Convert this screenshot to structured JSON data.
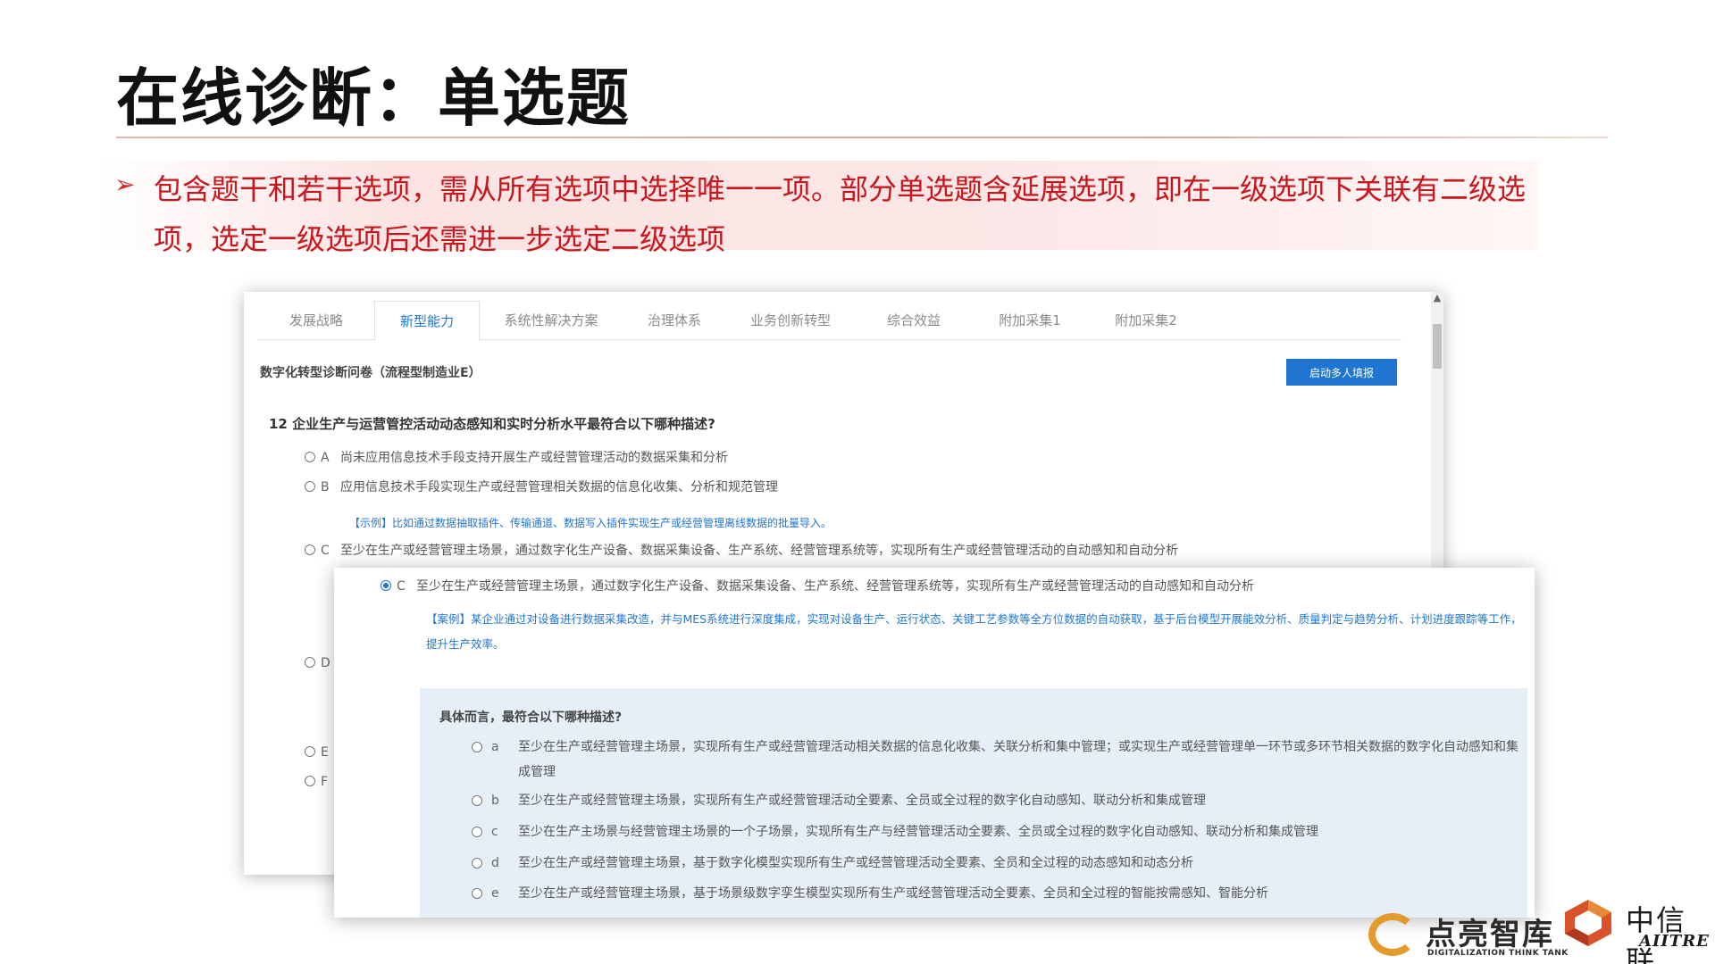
{
  "slide": {
    "title": "在线诊断：单选题",
    "description": "包含题干和若干选项，需从所有选项中选择唯一一项。部分单选题含延展选项，即在一级选项下关联有二级选项，选定一级选项后还需进一步选定二级选项"
  },
  "tabs": [
    "发展战略",
    "新型能力",
    "系统性解决方案",
    "治理体系",
    "业务创新转型",
    "综合效益",
    "附加采集1",
    "附加采集2"
  ],
  "active_tab": "新型能力",
  "questionnaire": {
    "title": "数字化转型诊断问卷（流程型制造业E）",
    "start_button": "启动多人填报",
    "question_no": "12",
    "question": "企业生产与运营管控活动动态感知和实时分析水平最符合以下哪种描述?",
    "options": [
      {
        "letter": "A",
        "text": "尚未应用信息技术手段支持开展生产或经营管理活动的数据采集和分析"
      },
      {
        "letter": "B",
        "text": "应用信息技术手段实现生产或经营管理相关数据的信息化收集、分析和规范管理"
      },
      {
        "letter": "C",
        "text": "至少在生产或经营管理主场景，通过数字化生产设备、数据采集设备、生产系统、经营管理系统等，实现所有生产或经营管理活动的自动感知和自动分析"
      },
      {
        "letter": "D",
        "text": ""
      },
      {
        "letter": "E",
        "text": ""
      },
      {
        "letter": "F",
        "text": ""
      }
    ],
    "example_b": "【示例】比如通过数据抽取插件、传输通道、数据写入插件实现生产或经营管理离线数据的批量导入。"
  },
  "expanded": {
    "letter": "C",
    "text": "至少在生产或经营管理主场景，通过数字化生产设备、数据采集设备、生产系统、经营管理系统等，实现所有生产或经营管理活动的自动感知和自动分析",
    "case": "【案例】某企业通过对设备进行数据采集改造，并与MES系统进行深度集成，实现对设备生产、运行状态、关键工艺参数等全方位数据的自动获取，基于后台模型开展能效分析、质量判定与趋势分析、计划进度跟踪等工作，提升生产效率。",
    "sub_question": "具体而言，最符合以下哪种描述?",
    "sub_options": [
      {
        "letter": "a",
        "text": "至少在生产或经营管理主场景，实现所有生产或经营管理活动相关数据的信息化收集、关联分析和集中管理；或实现生产或经营管理单一环节或多环节相关数据的数字化自动感知和集成管理"
      },
      {
        "letter": "b",
        "text": "至少在生产或经营管理主场景，实现所有生产或经营管理活动全要素、全员或全过程的数字化自动感知、联动分析和集成管理"
      },
      {
        "letter": "c",
        "text": "至少在生产主场景与经营管理主场景的一个子场景，实现所有生产与经营管理活动全要素、全员或全过程的数字化自动感知、联动分析和集成管理"
      },
      {
        "letter": "d",
        "text": "至少在生产或经营管理主场景，基于数字化模型实现所有生产或经营管理活动全要素、全员和全过程的动态感知和动态分析"
      },
      {
        "letter": "e",
        "text": "至少在生产或经营管理主场景，基于场景级数字孪生模型实现所有生产或经营管理活动全要素、全员和全过程的智能按需感知、智能分析"
      }
    ]
  },
  "logos": {
    "left_text": "点亮智库",
    "left_sub": "DIGITALIZATION THINK TANK",
    "right_text": "中信联",
    "right_sub": "AIITRE"
  },
  "colors": {
    "accent_red": "#c8161d",
    "link_blue": "#1f76d2",
    "sub_panel": "#e6eff8"
  }
}
